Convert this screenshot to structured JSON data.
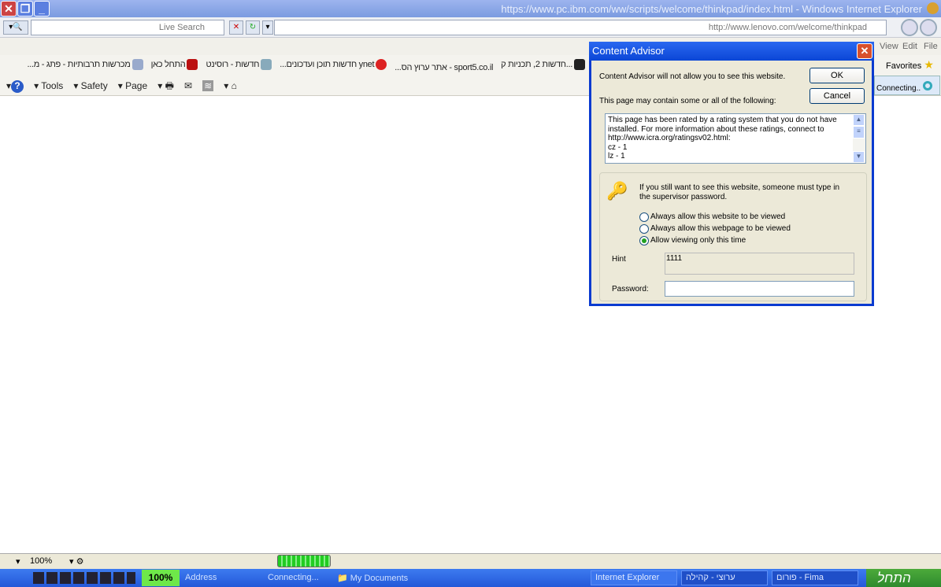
{
  "window": {
    "title": "https://www.pc.ibm.com/ww/scripts/welcome/thinkpad/index.html - Windows Internet Explorer"
  },
  "address": {
    "url": "http://www.lenovo.com/welcome/thinkpad",
    "search_placeholder": "Live Search"
  },
  "menu": [
    "View",
    "Edit",
    "File"
  ],
  "favorites": {
    "label": "Favorites",
    "items": [
      "...חדשות 2, תכניות ק",
      "sport5.co.il - אתר ערוץ הס...",
      "ynet חדשות תוכן ועדכונים...",
      "חדשות - רוסינט",
      "התחל כאן",
      "מכרשות תרבותיות - פתג - מ..."
    ]
  },
  "command_bar": {
    "tools": "Tools",
    "safety": "Safety",
    "page": "Page",
    "status": "Connecting.."
  },
  "status": {
    "zoom": "100%",
    "progress": 100
  },
  "taskbar": {
    "battery": "100%",
    "address": "Address",
    "connecting": "Connecting...",
    "docs": "My Documents",
    "start": "התחל",
    "tasks": [
      "Internet Explorer",
      "ערוצי - קהילה",
      "פורום - Fima"
    ]
  },
  "dialog": {
    "title": "Content Advisor",
    "message": "Content Advisor will not allow you to see this website.",
    "ok": "OK",
    "cancel": "Cancel",
    "may_contain": "This page may contain some or all of the following:",
    "ratings_text": [
      "This page has been rated by a rating system that you do not have installed. For more information about these ratings, connect to http://www.icra.org/ratingsv02.html:",
      "cz - 1",
      "lz - 1"
    ],
    "password_msg": "If you still want to see this website, someone must type in the supervisor password.",
    "options": [
      "Always allow this website to be viewed",
      "Always allow this webpage to be viewed",
      "Allow viewing only this time"
    ],
    "selected_option": 2,
    "hint_label": "Hint",
    "hint_value": "1111",
    "password_label": "Password:",
    "password_value": ""
  }
}
